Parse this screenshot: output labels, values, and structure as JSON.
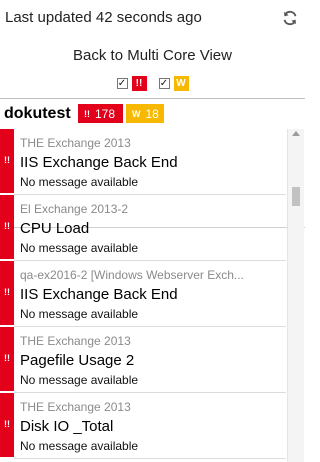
{
  "header": {
    "updated_text": "Last updated 42 seconds ago",
    "refresh_icon": "refresh-icon",
    "back_link": "Back to Multi Core View",
    "filters": {
      "error_checkbox": "✓",
      "error_icon_glyph": "!!",
      "warning_checkbox": "✓",
      "warning_icon_glyph": "W"
    }
  },
  "group": {
    "name": "dokutest",
    "error_badge": {
      "icon": "!!",
      "count": "178"
    },
    "warning_badge": {
      "icon": "W",
      "count": "18"
    }
  },
  "alerts": [
    {
      "source": "THE Exchange 2013",
      "title": "IIS Exchange Back End",
      "message": "No message available",
      "icon": "!!"
    },
    {
      "source": "El Exchange 2013-2",
      "title": "CPU Load",
      "message": "No message available",
      "icon": "!!"
    },
    {
      "source": "qa-ex2016-2 [Windows Webserver Exch...",
      "title": "IIS Exchange Back End",
      "message": "No message available",
      "icon": "!!"
    },
    {
      "source": "THE Exchange 2013",
      "title": "Pagefile Usage 2",
      "message": "No message available",
      "icon": "!!"
    },
    {
      "source": "THE Exchange 2013",
      "title": "Disk IO _Total",
      "message": "No message available",
      "icon": "!!"
    }
  ],
  "colors": {
    "error": "#e2001a",
    "warning": "#f6b800"
  }
}
